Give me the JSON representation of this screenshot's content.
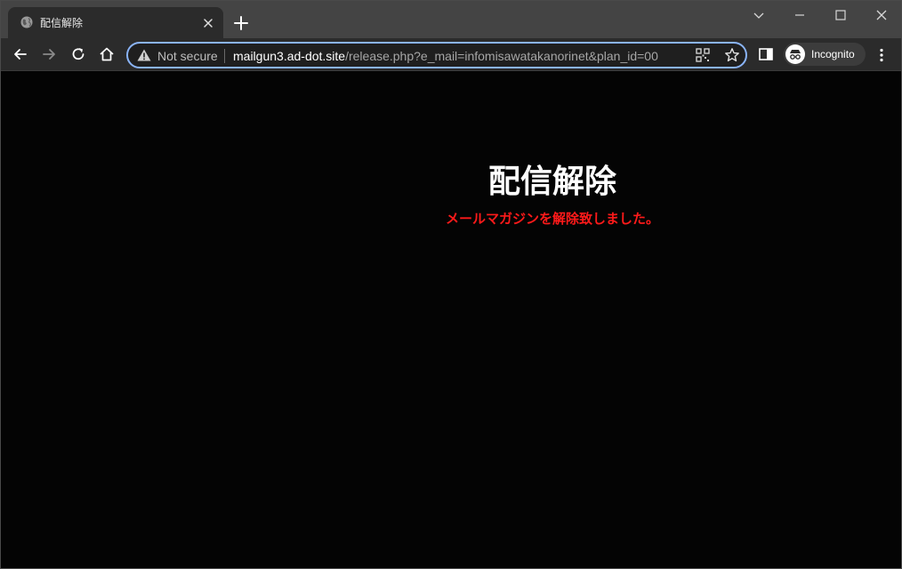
{
  "tab": {
    "title": "配信解除",
    "favicon": "globe-icon",
    "close": "close-icon"
  },
  "window_controls": [
    "chevron-down-icon",
    "minimize-icon",
    "maximize-icon",
    "close-icon"
  ],
  "toolbar": {
    "security_label": "Not secure",
    "url_host": "mailgun3.ad-dot.site",
    "url_path": "/release.php?e_mail=infomisawatakanorinet&plan_id=00",
    "profile_label": "Incognito"
  },
  "page": {
    "title": "配信解除",
    "message": "メールマガジンを解除致しました。"
  },
  "colors": {
    "accent": "#8ab4f8",
    "message": "#ff1a1a",
    "background": "#040404"
  }
}
